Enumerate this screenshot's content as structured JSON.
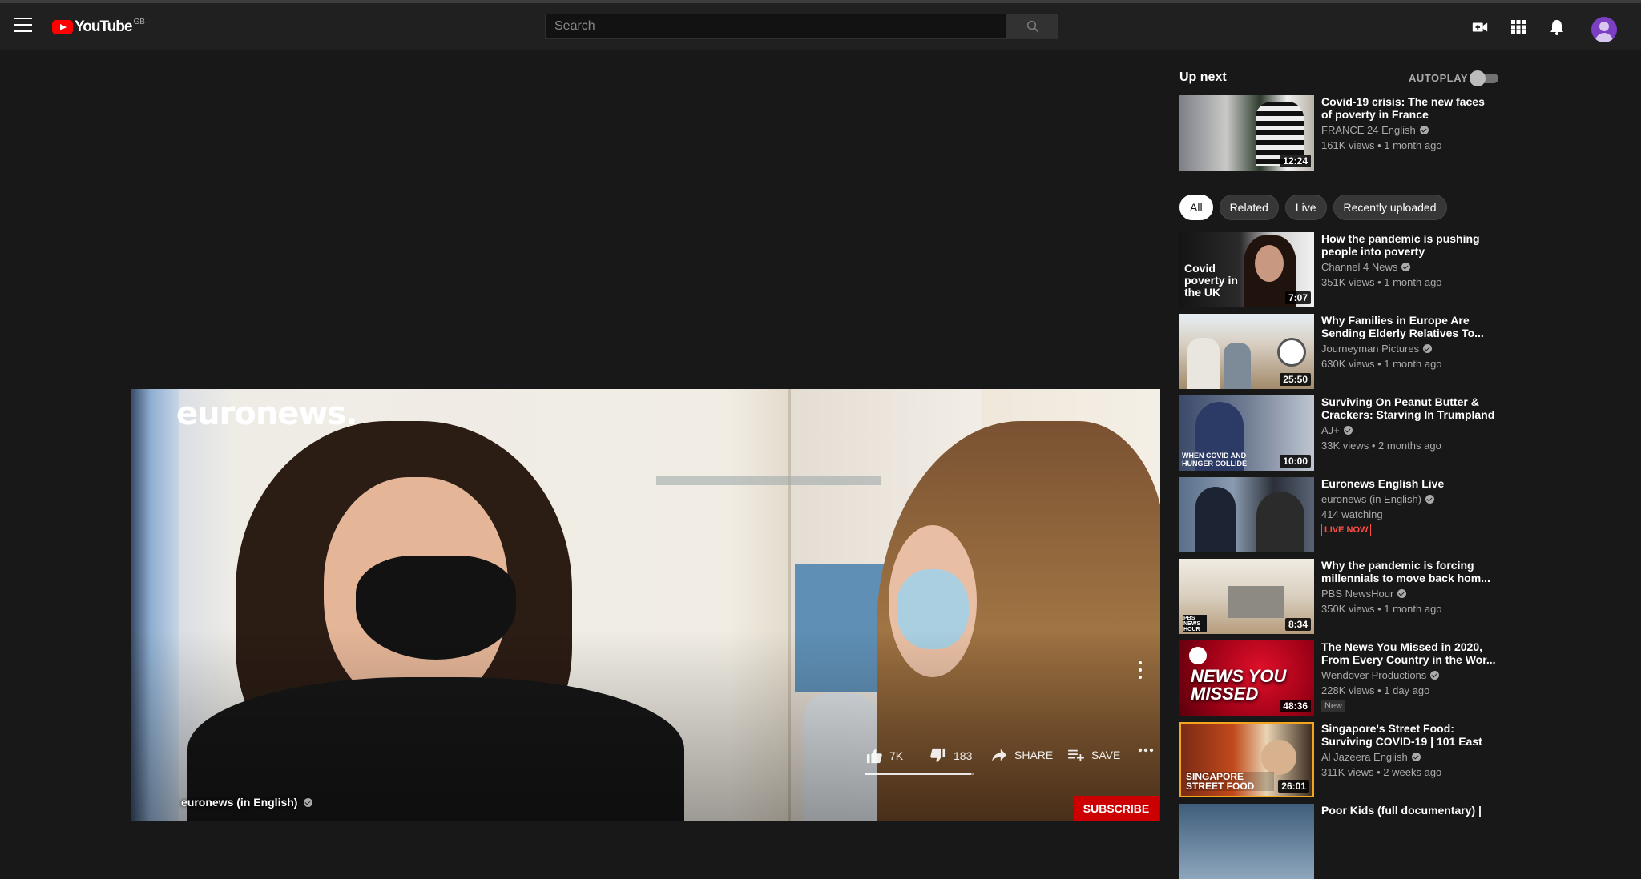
{
  "header": {
    "logo_text": "YouTube",
    "region": "GB",
    "search_placeholder": "Search"
  },
  "player": {
    "brand_watermark": "euronews.",
    "channel_name": "euronews (in English)",
    "likes": "7K",
    "dislikes": "183",
    "share_label": "SHARE",
    "save_label": "SAVE",
    "subscribe_label": "SUBSCRIBE",
    "sentiment_like_fraction": 0.97
  },
  "sidebar": {
    "up_next_label": "Up next",
    "autoplay_label": "AUTOPLAY",
    "autoplay_on": false,
    "up_next": {
      "title": "Covid-19 crisis: The new faces of poverty in France",
      "channel": "FRANCE 24 English",
      "stats": "161K views • 1 month ago",
      "duration": "12:24"
    },
    "chips": [
      "All",
      "Related",
      "Live",
      "Recently uploaded"
    ],
    "videos": [
      {
        "title": "How the pandemic is pushing people into poverty",
        "channel": "Channel 4 News",
        "stats": "351K views • 1 month ago",
        "duration": "7:07",
        "thumb_text": "Covid poverty in the UK"
      },
      {
        "title": "Why Families in Europe Are Sending Elderly Relatives To...",
        "channel": "Journeyman Pictures",
        "stats": "630K views • 1 month ago",
        "duration": "25:50"
      },
      {
        "title": "Surviving On Peanut Butter & Crackers: Starving In Trumpland",
        "channel": "AJ+",
        "stats": "33K views • 2 months ago",
        "duration": "10:00",
        "thumb_text": "WHEN COVID AND HUNGER COLLIDE"
      },
      {
        "title": "Euronews English Live",
        "channel": "euronews (in English)",
        "stats": "414 watching",
        "badge": "LIVE NOW"
      },
      {
        "title": "Why the pandemic is forcing millennials to move back hom...",
        "channel": "PBS NewsHour",
        "stats": "350K views • 1 month ago",
        "duration": "8:34",
        "thumb_text": "PBS NEWS HOUR"
      },
      {
        "title": "The News You Missed in 2020, From Every Country in the Wor...",
        "channel": "Wendover Productions",
        "stats": "228K views • 1 day ago",
        "duration": "48:36",
        "badge": "New",
        "thumb_text": "NEWS YOU MISSED"
      },
      {
        "title": "Singapore's Street Food: Surviving COVID-19 | 101 East",
        "channel": "Al Jazeera English",
        "stats": "311K views • 2 weeks ago",
        "duration": "26:01",
        "thumb_text": "SINGAPORE STREET FOOD"
      },
      {
        "title": "Poor Kids (full documentary) |",
        "channel": "",
        "stats": ""
      }
    ]
  }
}
